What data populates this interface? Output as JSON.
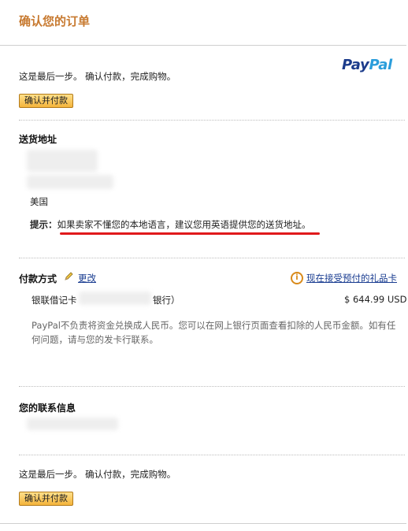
{
  "header": {
    "title": "确认您的订单"
  },
  "brand": {
    "pay": "Pay",
    "pal": "Pal"
  },
  "intro": {
    "text": "这是最后一步。 确认付款，完成购物。",
    "button": "确认并付款"
  },
  "shipping": {
    "heading": "送货地址",
    "country": "美国",
    "hint_label": "提示：",
    "hint_text": "如果卖家不懂您的本地语言，建议您用英语提供您的送货地址。"
  },
  "payment": {
    "heading": "付款方式",
    "change_link": "更改",
    "gift_card_link": "现在接受预付的礼品卡",
    "card_prefix": "银联借记卡",
    "card_suffix": "银行）",
    "amount": "$ 644.99 USD",
    "note": "PayPal不负责将资金兑换成人民币。您可以在网上银行页面查看扣除的人民币金额。如有任何问题，请与您的发卡行联系。"
  },
  "contact": {
    "heading": "您的联系信息"
  },
  "footer": {
    "text": "这是最后一步。 确认付款，完成购物。",
    "button": "确认并付款"
  },
  "colors": {
    "accent": "#c7792f",
    "link": "#1a3d91",
    "underline": "#e0191b",
    "button": "#f4b43c"
  }
}
